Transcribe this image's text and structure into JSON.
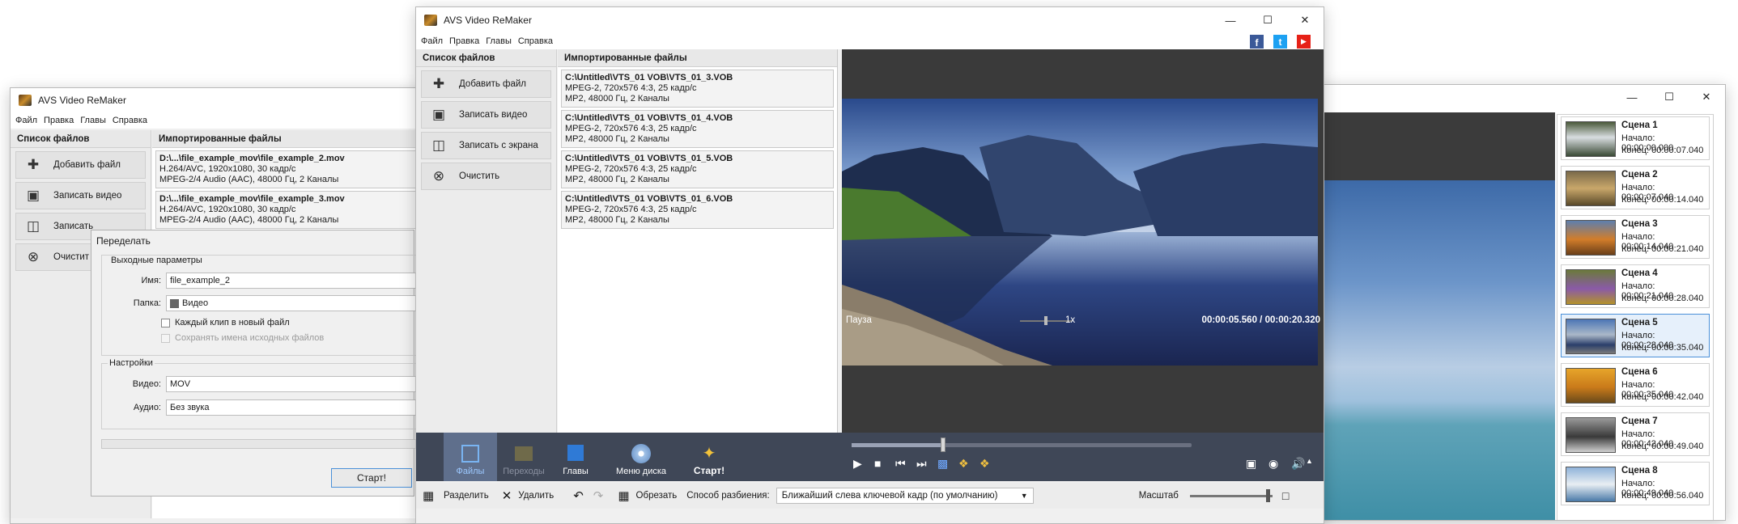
{
  "left_window": {
    "title": "AVS Video ReMaker",
    "menu": [
      "Файл",
      "Правка",
      "Главы",
      "Справка"
    ],
    "sidebar_header": "Список файлов",
    "files_header": "Импортированные файлы",
    "buttons": {
      "add": "Добавить файл",
      "record": "Записать видео",
      "screen": "Записать",
      "clear": "Очистит"
    },
    "files": [
      {
        "path": "D:\\...\\file_example_mov\\file_example_2.mov",
        "line1": "H.264/AVC, 1920x1080, 30 кадр/с",
        "line2": "MPEG-2/4 Audio (AAC), 48000 Гц, 2 Каналы"
      },
      {
        "path": "D:\\...\\file_example_mov\\file_example_3.mov",
        "line1": "H.264/AVC, 1920x1080, 30 кадр/с",
        "line2": "MPEG-2/4 Audio (AAC), 48000 Гц, 2 Каналы"
      }
    ]
  },
  "dialog": {
    "title": "Переделать",
    "output_group": "Выходные параметры",
    "name_label": "Имя:",
    "name_value": "file_example_2",
    "folder_label": "Папка:",
    "folder_value": "Видео",
    "each_clip": "Каждый клип в новый файл",
    "keep_names": "Сохранять имена исходных файлов",
    "settings_group": "Настройки",
    "video_label": "Видео:",
    "video_value": "MOV",
    "audio_label": "Аудио:",
    "audio_value": "Без звука",
    "start": "Старт!"
  },
  "main_window": {
    "title": "AVS Video ReMaker",
    "menu": [
      "Файл",
      "Правка",
      "Главы",
      "Справка"
    ],
    "sidebar_header": "Список файлов",
    "files_header": "Импортированные файлы",
    "buttons": {
      "add": "Добавить файл",
      "record": "Записать видео",
      "screen": "Записать с экрана",
      "clear": "Очистить"
    },
    "files": [
      {
        "path": "C:\\Untitled\\VTS_01 VOB\\VTS_01_3.VOB",
        "line1": "MPEG-2, 720x576 4:3, 25 кадр/с",
        "line2": "MP2, 48000 Гц, 2 Каналы"
      },
      {
        "path": "C:\\Untitled\\VTS_01 VOB\\VTS_01_4.VOB",
        "line1": "MPEG-2, 720x576 4:3, 25 кадр/с",
        "line2": "MP2, 48000 Гц, 2 Каналы"
      },
      {
        "path": "C:\\Untitled\\VTS_01 VOB\\VTS_01_5.VOB",
        "line1": "MPEG-2, 720x576 4:3, 25 кадр/с",
        "line2": "MP2, 48000 Гц, 2 Каналы"
      },
      {
        "path": "C:\\Untitled\\VTS_01 VOB\\VTS_01_6.VOB",
        "line1": "MPEG-2, 720x576 4:3, 25 кадр/с",
        "line2": "MP2, 48000 Гц, 2 Каналы"
      }
    ],
    "player": {
      "status": "Пауза",
      "speed": "1x",
      "time_current": "00:00:05.560",
      "time_sep": "/",
      "time_total": "00:00:20.320",
      "progress": 0.27
    },
    "tools": {
      "files": "Файлы",
      "transitions": "Переходы",
      "chapters": "Главы",
      "disc_menu": "Меню диска",
      "start": "Старт!"
    },
    "bottom": {
      "split": "Разделить",
      "delete": "Удалить",
      "trim": "Обрезать",
      "split_method_label": "Способ разбиения:",
      "split_method_value": "Ближайший слева ключевой кадр (по умолчанию)",
      "scale_label": "Масштаб"
    },
    "colors": {
      "toolbar_bg": "#3f4757",
      "accent": "#4a90d9",
      "facebook": "#3b5998",
      "twitter": "#1da1f2",
      "youtube": "#e62117"
    }
  },
  "right_window": {
    "scenes": [
      {
        "name": "Сцена 1",
        "start": "Начало: 00:00:00.000",
        "end": "Конец:   00:00:07.040"
      },
      {
        "name": "Сцена 2",
        "start": "Начало: 00:00:07.040",
        "end": "Конец:   00:00:14.040"
      },
      {
        "name": "Сцена 3",
        "start": "Начало: 00:00:14.040",
        "end": "Конец:   00:00:21.040"
      },
      {
        "name": "Сцена 4",
        "start": "Начало: 00:00:21.040",
        "end": "Конец:   00:00:28.040"
      },
      {
        "name": "Сцена 5",
        "start": "Начало: 00:00:28.040",
        "end": "Конец:   00:00:35.040"
      },
      {
        "name": "Сцена 6",
        "start": "Начало: 00:00:35.040",
        "end": "Конец:   00:00:42.040"
      },
      {
        "name": "Сцена 7",
        "start": "Начало: 00:00:42.040",
        "end": "Конец:   00:00:49.040"
      },
      {
        "name": "Сцена 8",
        "start": "Начало: 00:00:49.040",
        "end": "Конец:   00:00:56.040"
      }
    ]
  }
}
